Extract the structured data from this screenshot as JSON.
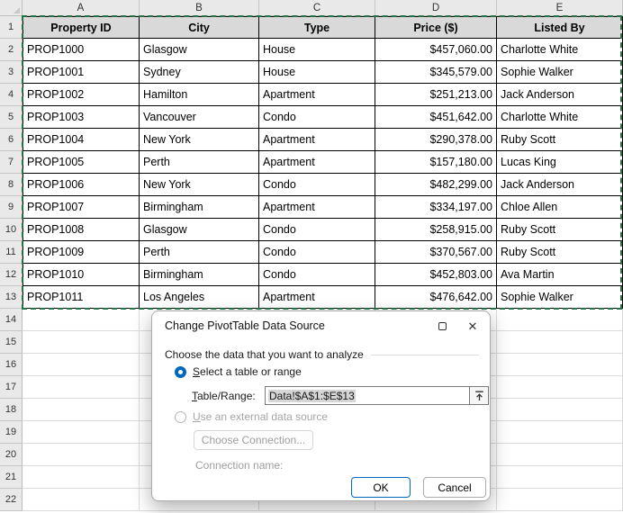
{
  "spreadsheet": {
    "column_headers": [
      "A",
      "B",
      "C",
      "D",
      "E"
    ],
    "row_numbers": [
      1,
      2,
      3,
      4,
      5,
      6,
      7,
      8,
      9,
      10,
      11,
      12,
      13,
      14,
      15,
      16,
      17,
      18,
      19,
      20,
      21,
      22
    ],
    "table": {
      "headers": [
        "Property ID",
        "City",
        "Type",
        "Price ($)",
        "Listed By"
      ],
      "rows": [
        [
          "PROP1000",
          "Glasgow",
          "House",
          "$457,060.00",
          "Charlotte White"
        ],
        [
          "PROP1001",
          "Sydney",
          "House",
          "$345,579.00",
          "Sophie Walker"
        ],
        [
          "PROP1002",
          "Hamilton",
          "Apartment",
          "$251,213.00",
          "Jack Anderson"
        ],
        [
          "PROP1003",
          "Vancouver",
          "Condo",
          "$451,642.00",
          "Charlotte White"
        ],
        [
          "PROP1004",
          "New York",
          "Apartment",
          "$290,378.00",
          "Ruby Scott"
        ],
        [
          "PROP1005",
          "Perth",
          "Apartment",
          "$157,180.00",
          "Lucas King"
        ],
        [
          "PROP1006",
          "New York",
          "Condo",
          "$482,299.00",
          "Jack Anderson"
        ],
        [
          "PROP1007",
          "Birmingham",
          "Apartment",
          "$334,197.00",
          "Chloe Allen"
        ],
        [
          "PROP1008",
          "Glasgow",
          "Condo",
          "$258,915.00",
          "Ruby Scott"
        ],
        [
          "PROP1009",
          "Perth",
          "Condo",
          "$370,567.00",
          "Ruby Scott"
        ],
        [
          "PROP1010",
          "Birmingham",
          "Condo",
          "$452,803.00",
          "Ava Martin"
        ],
        [
          "PROP1011",
          "Los Angeles",
          "Apartment",
          "$476,642.00",
          "Sophie Walker"
        ]
      ]
    },
    "selected_range": "A1:E13"
  },
  "dialog": {
    "title": "Change PivotTable Data Source",
    "prompt": "Choose the data that you want to analyze",
    "radio_table_range_label": "Select a table or range",
    "table_range_label": "Table/Range:",
    "table_range_value": "Data!$A$1:$E$13",
    "radio_external_label": "Use an external data source",
    "choose_connection_label": "Choose Connection...",
    "connection_name_label": "Connection name:",
    "ok_label": "OK",
    "cancel_label": "Cancel"
  },
  "icons": {
    "close_glyph": "✕"
  },
  "colors": {
    "accent_blue": "#0067C0",
    "selection_green": "#217346",
    "table_header_fill": "#D9D9D9",
    "sheet_header_fill": "#E9E9E9"
  }
}
